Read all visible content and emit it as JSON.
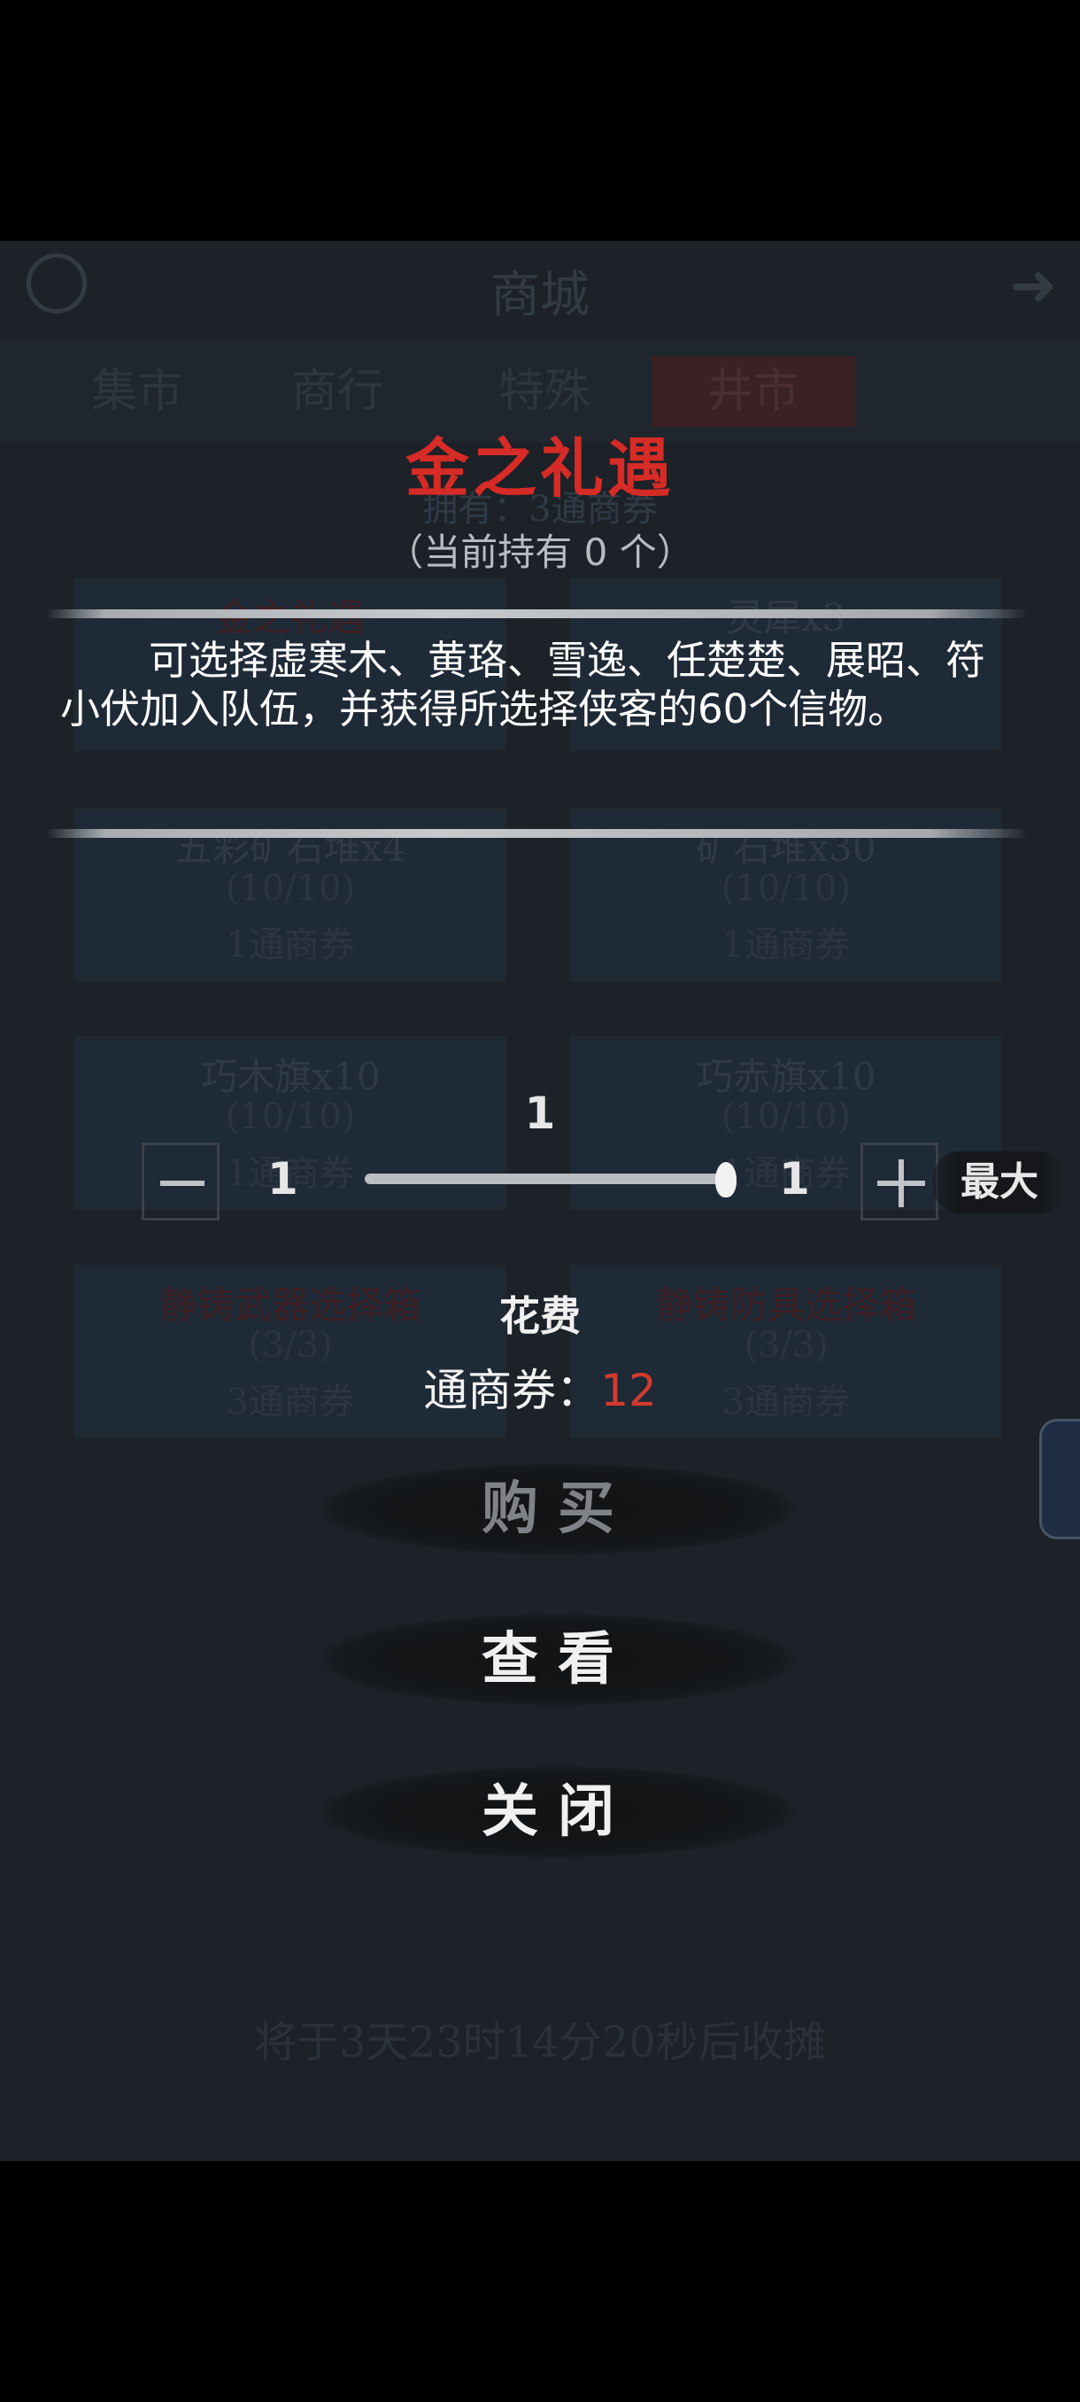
{
  "background_shop": {
    "header_title": "商城",
    "tabs": [
      "集市",
      "商行",
      "特殊",
      "井市"
    ],
    "owned": "拥有：3通商券",
    "cards": [
      {
        "title": "金之礼遇",
        "count": "",
        "price": ""
      },
      {
        "title": "灵犀x3",
        "count": "",
        "price": ""
      },
      {
        "title": "五彩矿石堆x4",
        "count": "(10/10)",
        "price": "1通商券"
      },
      {
        "title": "矿石堆x30",
        "count": "(10/10)",
        "price": "1通商券"
      },
      {
        "title": "巧木旗x10",
        "count": "(10/10)",
        "price": "1通商券"
      },
      {
        "title": "巧赤旗x10",
        "count": "(10/10)",
        "price": "1通商券"
      },
      {
        "title": "静铸武器选择箱",
        "count": "(3/3)",
        "price": "3通商券"
      },
      {
        "title": "静铸防具选择箱",
        "count": "(3/3)",
        "price": "3通商券"
      }
    ],
    "footer": "将于3天23时14分20秒后收摊"
  },
  "dialog": {
    "title": "金之礼遇",
    "held": "（当前持有 0 个）",
    "description": "可选择虚寒木、黄珞、雪逸、任楚楚、展昭、符小伏加入队伍，并获得所选择侠客的60个信物。",
    "quantity": {
      "current": "1",
      "min": "1",
      "max": "1",
      "fraction": 1.0,
      "max_label": "最大"
    },
    "cost": {
      "title": "花费",
      "label": "通商券：",
      "value": "12"
    },
    "buttons": {
      "buy": "购买",
      "view": "查看",
      "close": "关闭"
    }
  },
  "colors": {
    "title_red": "#d62b26",
    "cost_red": "#d33a2e",
    "buy_disabled": "#7f8286"
  }
}
